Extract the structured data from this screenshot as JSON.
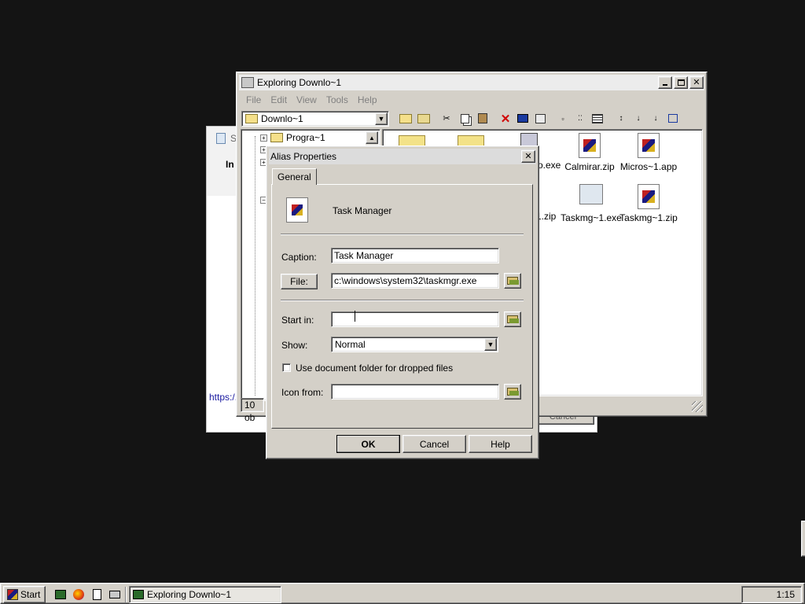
{
  "background_window": {
    "title_fragment": "S",
    "content_fragment": "In",
    "link_fragment": "https:/.",
    "button_fragment": "Cancel"
  },
  "explorer": {
    "title": "Exploring Downlo~1",
    "menu": [
      "File",
      "Edit",
      "View",
      "Tools",
      "Help"
    ],
    "address_value": "Downlo~1",
    "tree_items": [
      {
        "label": "Progra~1"
      }
    ],
    "files": [
      {
        "label": "o.exe"
      },
      {
        "label": "Calmirar.zip"
      },
      {
        "label": "Micros~1.app"
      },
      {
        "label": "1.zip"
      },
      {
        "label": "Taskmg~1.exe"
      },
      {
        "label": "Taskmg~1.zip"
      }
    ],
    "status_text": "10 ob"
  },
  "dialog": {
    "title": "Alias Properties",
    "tab_label": "General",
    "app_name": "Task Manager",
    "caption_label": "Caption:",
    "caption_value": "Task Manager",
    "file_button_label": "File:",
    "file_value": "c:\\windows\\system32\\taskmgr.exe",
    "start_in_label": "Start in:",
    "start_in_value": "",
    "show_label": "Show:",
    "show_value": "Normal",
    "checkbox_label": "Use document folder for dropped files",
    "checkbox_checked": false,
    "icon_from_label": "Icon from:",
    "icon_from_value": "",
    "ok_label": "OK",
    "cancel_label": "Cancel",
    "help_label": "Help"
  },
  "taskbar": {
    "start_label": "Start",
    "task_label": "Exploring Downlo~1",
    "clock": "1:15"
  }
}
